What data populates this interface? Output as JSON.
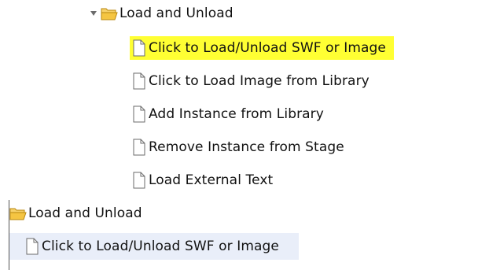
{
  "top_tree": {
    "folder": {
      "label": "Load and Unload",
      "icon": "folder-open-icon",
      "expanded": true
    },
    "items": [
      {
        "label": "Click to Load/Unload SWF or Image",
        "icon": "document-icon",
        "highlighted": true
      },
      {
        "label": "Click to Load Image from Library",
        "icon": "document-icon",
        "highlighted": false
      },
      {
        "label": "Add Instance from Library",
        "icon": "document-icon",
        "highlighted": false
      },
      {
        "label": "Remove Instance from Stage",
        "icon": "document-icon",
        "highlighted": false
      },
      {
        "label": "Load External Text",
        "icon": "document-icon",
        "highlighted": false
      }
    ]
  },
  "lower_tree": {
    "folder": {
      "label": "Load and Unload",
      "icon": "folder-open-icon"
    },
    "selected_item": {
      "label": "Click to Load/Unload SWF or Image",
      "icon": "document-icon"
    }
  },
  "colors": {
    "highlight": "#ffff33",
    "selection": "#e9eef9",
    "folder_fill": "#f5c542",
    "folder_stroke": "#b8860b"
  }
}
